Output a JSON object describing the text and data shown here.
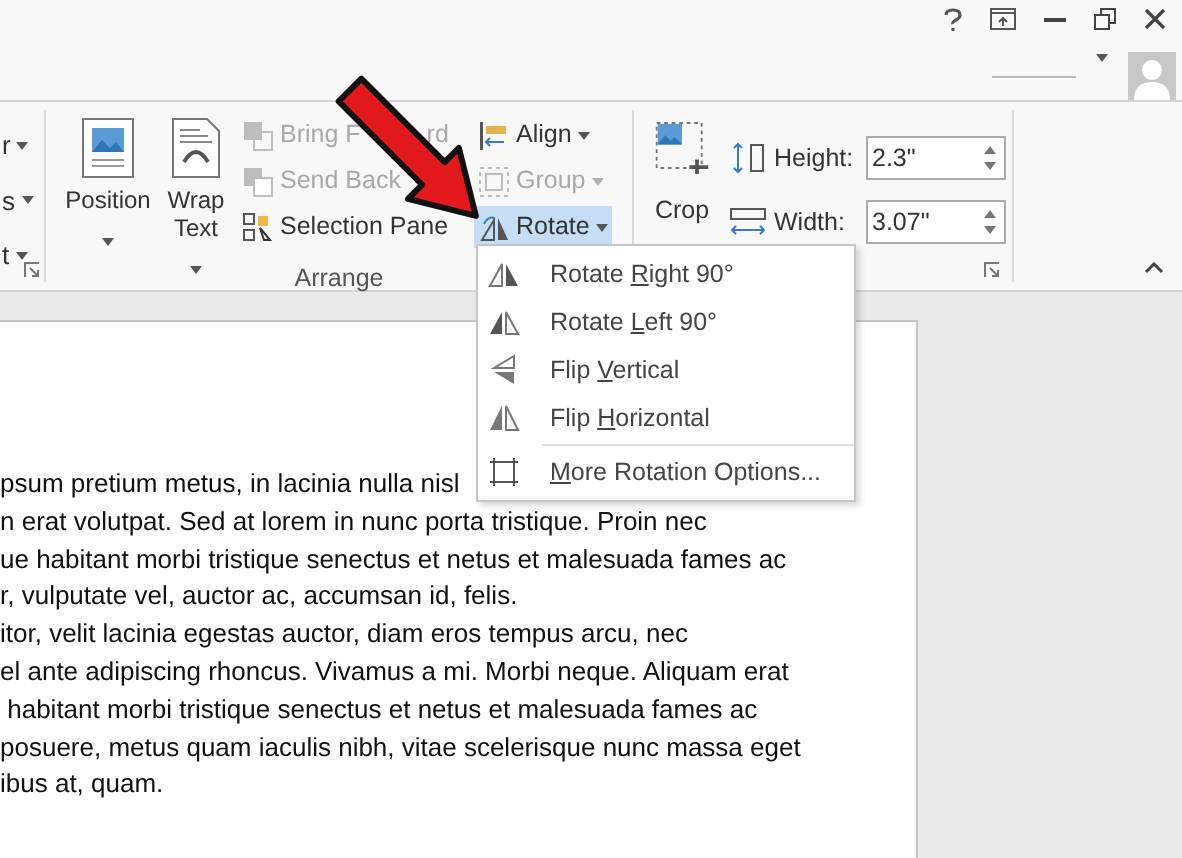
{
  "ribbon": {
    "left_group": {
      "items": [
        "r",
        "s",
        "t"
      ]
    },
    "arrange_group": {
      "label": "Arrange",
      "large_buttons": [
        {
          "label": "Position"
        },
        {
          "label": "Wrap Text"
        }
      ],
      "columns": [
        [
          {
            "label": "Bring F",
            "label_tail": "rd",
            "disabled": true,
            "active": false
          },
          {
            "label": "Send Back",
            "disabled": true,
            "active": false
          },
          {
            "label": "Selection Pane",
            "disabled": false,
            "active": false
          }
        ],
        [
          {
            "label": "Align",
            "disabled": false,
            "active": false
          },
          {
            "label": "Group",
            "disabled": true,
            "active": false
          },
          {
            "label": "Rotate",
            "disabled": false,
            "active": true
          }
        ]
      ]
    },
    "size_group": {
      "crop": "Crop",
      "fields": [
        {
          "label": "Height:",
          "value": "2.3\""
        },
        {
          "label": "Width:",
          "value": "3.07\""
        }
      ]
    }
  },
  "rotate_menu": {
    "items": [
      {
        "before": "Rotate ",
        "key": "R",
        "after": "ight 90°"
      },
      {
        "before": "Rotate ",
        "key": "L",
        "after": "eft 90°"
      },
      {
        "before": "Flip ",
        "key": "V",
        "after": "ertical"
      },
      {
        "before": "Flip ",
        "key": "H",
        "after": "orizontal"
      },
      {
        "key": "M",
        "after": "ore Rotation Options..."
      }
    ]
  },
  "document": {
    "lines": [
      "psum pretium metus, in lacinia nulla nisl",
      "n erat volutpat. Sed at lorem in nunc porta tristique. Proin nec",
      "ue habitant morbi tristique senectus et netus et malesuada fames ac",
      "r, vulputate vel, auctor ac, accumsan id, felis.",
      "itor, velit lacinia egestas auctor, diam eros tempus arcu, nec",
      "el ante adipiscing rhoncus. Vivamus a mi. Morbi neque. Aliquam erat",
      " habitant morbi tristique senectus et netus et malesuada fames ac",
      "posuere, metus quam iaculis nibh, vitae scelerisque nunc massa eget",
      "ibus at, quam."
    ]
  }
}
